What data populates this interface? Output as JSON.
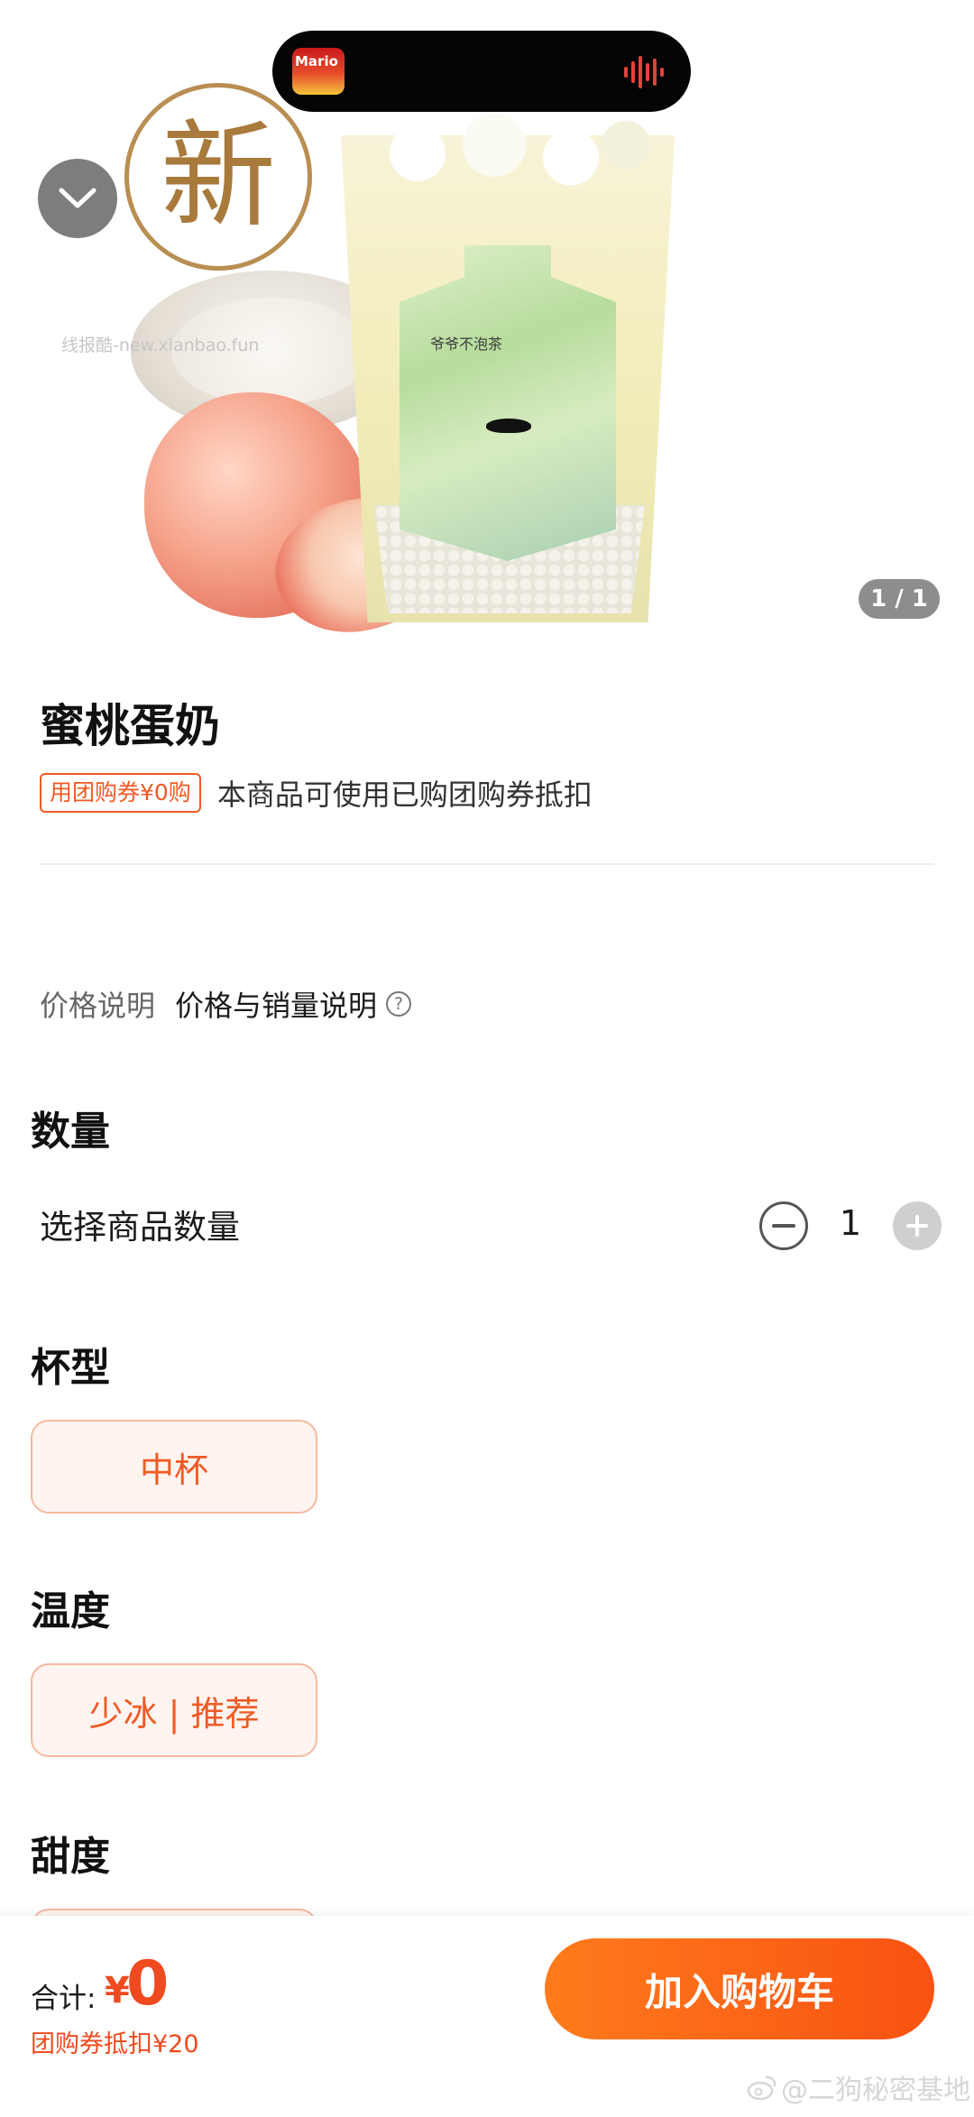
{
  "hero": {
    "app_thumb_text": "Mario",
    "new_badge": "新",
    "watermark": "线报酷-new.xianbao.fun",
    "cup_brand": "爷爷不泡茶",
    "page_indicator": "1 / 1"
  },
  "product": {
    "name": "蜜桃蛋奶",
    "coupon_tag": "用团购券¥0购",
    "coupon_desc": "本商品可使用已购团购券抵扣",
    "price_label": "价格说明",
    "price_link": "价格与销量说明",
    "help_icon": "?"
  },
  "quantity": {
    "title": "数量",
    "label": "选择商品数量",
    "value": "1"
  },
  "cup_size": {
    "title": "杯型",
    "selected": "中杯"
  },
  "temperature": {
    "title": "温度",
    "selected": "少冰 | 推荐"
  },
  "sweetness": {
    "title": "甜度"
  },
  "bottom_bar": {
    "total_label": "合计:",
    "currency": "¥",
    "total_value": "0",
    "discount": "团购券抵扣¥20",
    "cart_button": "加入购物车",
    "watermark": "@二狗秘密基地"
  },
  "colors": {
    "accent": "#ef4a20",
    "button_gradient_start": "#ff7b1c",
    "button_gradient_end": "#f85212",
    "option_bg": "#fff4ef",
    "option_border": "#f5b9a1"
  },
  "icons": {
    "collapse": "chevron-down-icon",
    "help": "help-circle-icon",
    "minus": "minus-circle-icon",
    "plus": "plus-circle-icon",
    "audio": "waveform-icon",
    "weibo": "weibo-icon"
  }
}
